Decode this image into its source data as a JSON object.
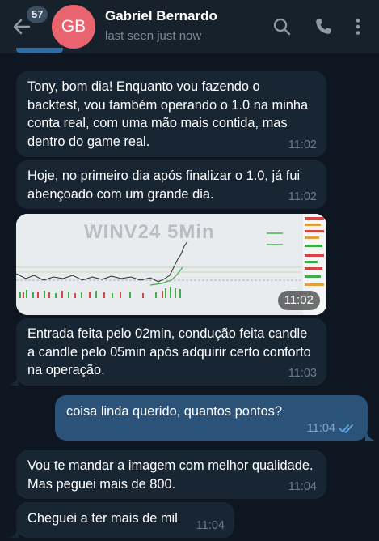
{
  "header": {
    "back_icon": "arrow-left-icon",
    "unread_count": "57",
    "avatar_initials": "GB",
    "avatar_color": "#e8656f",
    "contact_name": "Gabriel Bernardo",
    "status": "last seen just now",
    "icons": [
      "search-icon",
      "phone-icon",
      "more-vertical-icon"
    ]
  },
  "messages": [
    {
      "direction": "incoming",
      "text": "Tony, bom dia! Enquanto vou fazendo o backtest, vou também operando o 1.0 na minha conta real, com uma mão mais contida, mas dentro do game real.",
      "time": "11:02"
    },
    {
      "direction": "incoming",
      "text": "Hoje, no primeiro dia após finalizar o 1.0, já fui abençoado com um grande dia.",
      "time": "11:02"
    },
    {
      "direction": "incoming",
      "type": "photo",
      "photo_title": "WINV24 5Min",
      "time": "11:02"
    },
    {
      "direction": "incoming",
      "text": "Entrada feita pelo 02min, condução feita candle a candle pelo 05min após adquirir certo conforto na operação.",
      "time": "11:03"
    },
    {
      "direction": "outgoing",
      "text": "coisa linda querido, quantos pontos?",
      "time": "11:04",
      "status_icon": "double-check-icon"
    },
    {
      "direction": "incoming",
      "text": "Vou te mandar a imagem com melhor qualidade. Mas peguei mais de 800.",
      "time": "11:04"
    },
    {
      "direction": "incoming",
      "text": "Cheguei a ter mais de mil",
      "time": "11:04"
    }
  ],
  "colors": {
    "background": "#0e1621",
    "header": "#17212b",
    "incoming_bubble": "#182533",
    "outgoing_bubble": "#2b5278",
    "time_text": "#6d7f8f",
    "read_checks": "#5fa8e6"
  }
}
